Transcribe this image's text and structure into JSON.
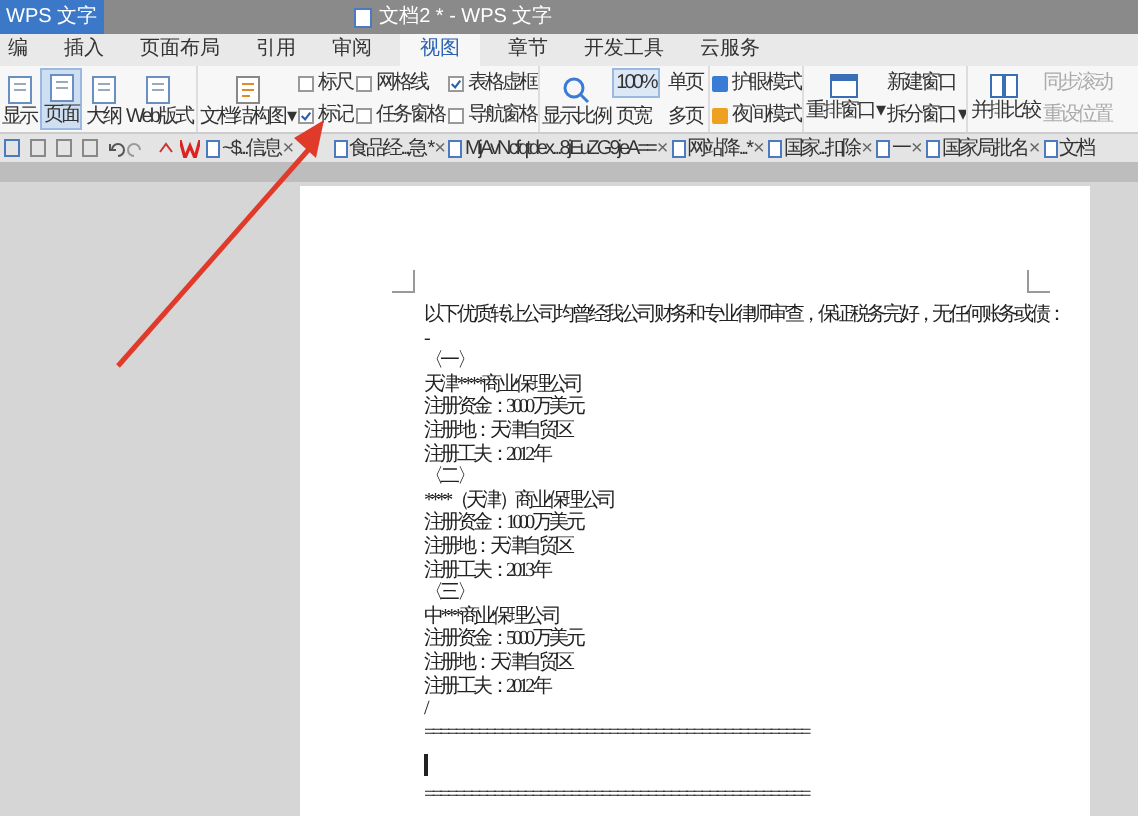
{
  "title_bar": {
    "app_button": "WPS 文字",
    "title": "文档2 * - WPS 文字"
  },
  "menu_tabs": [
    {
      "label": "编",
      "selected": false
    },
    {
      "label": "插入",
      "selected": false
    },
    {
      "label": "页面布局",
      "selected": false
    },
    {
      "label": "引用",
      "selected": false
    },
    {
      "label": "审阅",
      "selected": false
    },
    {
      "label": "视图",
      "selected": true
    },
    {
      "label": "章节",
      "selected": false
    },
    {
      "label": "开发工具",
      "selected": false
    },
    {
      "label": "云服务",
      "selected": false
    }
  ],
  "view_buttons": [
    {
      "label": "显示",
      "selected": false
    },
    {
      "label": "页面",
      "selected": true
    },
    {
      "label": "大纲",
      "selected": false
    },
    {
      "label": "Web版式",
      "selected": false
    }
  ],
  "doc_map": "文档结构图 ▾",
  "checkboxes": [
    {
      "label": "标尺",
      "checked": false
    },
    {
      "label": "网格线",
      "checked": false
    },
    {
      "label": "表格虚框",
      "checked": true
    },
    {
      "label": "标记",
      "checked": true
    },
    {
      "label": "任务窗格",
      "checked": false
    },
    {
      "label": "导航窗格",
      "checked": false
    }
  ],
  "zoom": {
    "label": "显示比例",
    "items": [
      {
        "label": "100%",
        "selected": true
      },
      {
        "label": "单页",
        "selected": false
      },
      {
        "label": "页宽",
        "selected": false
      },
      {
        "label": "多页",
        "selected": false
      }
    ]
  },
  "modes": [
    "护眼模式",
    "夜间模式"
  ],
  "windows": {
    "rearrange": "重排窗口 ▾",
    "new": "新建窗口",
    "split": "拆分窗口 ▾"
  },
  "compare": {
    "label": "并排比较",
    "items": [
      {
        "label": "同步滚动",
        "disabled": true
      },
      {
        "label": "重设位置",
        "disabled": true
      }
    ]
  },
  "doc_tabs": [
    {
      "label": "~$...信息",
      "close": "×"
    },
    {
      "label": "食品经...急 *",
      "close": "×"
    },
    {
      "label": "MjAvNcfqtdex...8jEuZG9jeA==",
      "close": "×"
    },
    {
      "label": "网站降...*",
      "close": "×"
    },
    {
      "label": "国家...扣除",
      "close": "×"
    },
    {
      "label": "一",
      "close": "×"
    },
    {
      "label": "国家局批名",
      "close": "×"
    },
    {
      "label": "文档"
    }
  ],
  "document": [
    {
      "kind": "text",
      "text": "以下优质转让公司均曾经我公司财务和专业律师审查，保证税务完好，无任何账务或债："
    },
    {
      "kind": "text",
      "text": "-"
    },
    {
      "kind": "text",
      "text": "〈一〉"
    },
    {
      "kind": "text",
      "text": "天津****商业保理公司"
    },
    {
      "kind": "text",
      "text": "注册资金：3000 万美元"
    },
    {
      "kind": "text",
      "text": "注册地：天津自贸区"
    },
    {
      "kind": "text",
      "text": "注册工夫：2012 年"
    },
    {
      "kind": "text",
      "text": "〈二〉"
    },
    {
      "kind": "text",
      "text": "****（天津）商业保理公司"
    },
    {
      "kind": "text",
      "text": "注册资金：1000 万美元"
    },
    {
      "kind": "text",
      "text": "注册地：天津自贸区"
    },
    {
      "kind": "text",
      "text": "注册工夫：2013 年"
    },
    {
      "kind": "text",
      "text": "〈三〉"
    },
    {
      "kind": "text",
      "text": "中***商业保理公司"
    },
    {
      "kind": "text",
      "text": "注册资金：5000 万美元"
    },
    {
      "kind": "text",
      "text": "注册地：天津自贸区"
    },
    {
      "kind": "text",
      "text": "注册工夫：2012 年"
    },
    {
      "kind": "text",
      "text": "/"
    },
    {
      "kind": "text",
      "text": "=================================================="
    },
    {
      "kind": "cursor"
    },
    {
      "kind": "text",
      "text": "=================================================="
    }
  ]
}
